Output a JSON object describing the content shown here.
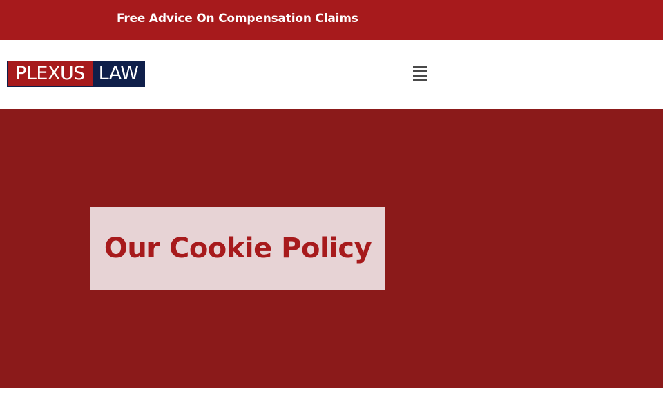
{
  "topbar": {
    "text": "Free Advice On Compensation Claims",
    "background": "#a71a1c"
  },
  "header": {
    "logo": {
      "part1": "PLEXUS",
      "part2": "LAW",
      "colors": {
        "left": "#a71a1c",
        "right": "#0f1f4a"
      }
    },
    "menu_icon": "hamburger-menu-icon"
  },
  "hero": {
    "background": "#8b1a1a",
    "title": "Our Cookie Policy",
    "title_box_color": "#e7d3d5",
    "title_color": "#a71a1c"
  }
}
